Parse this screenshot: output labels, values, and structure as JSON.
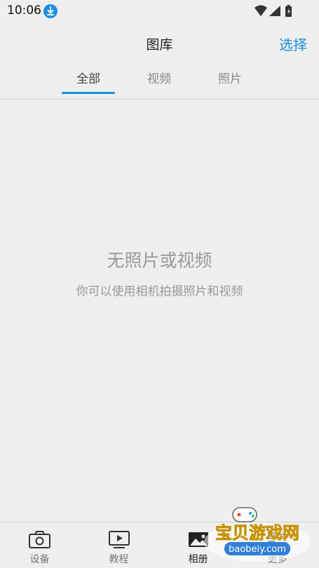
{
  "status_bar": {
    "time": "10:06"
  },
  "header": {
    "title": "图库",
    "select_label": "选择"
  },
  "tabs": [
    {
      "label": "全部",
      "active": true
    },
    {
      "label": "视频",
      "active": false
    },
    {
      "label": "照片",
      "active": false
    }
  ],
  "empty_state": {
    "title": "无照片或视频",
    "description": "你可以使用相机拍摄照片和视频"
  },
  "bottom_nav": [
    {
      "label": "设备",
      "icon": "camera-icon",
      "active": false
    },
    {
      "label": "教程",
      "icon": "play-screen-icon",
      "active": false
    },
    {
      "label": "相册",
      "icon": "gallery-icon",
      "active": true
    },
    {
      "label": "更多",
      "icon": "more-icon",
      "active": false
    }
  ],
  "watermark": {
    "text": "宝贝游戏网",
    "url": "baobeiy.com"
  },
  "colors": {
    "accent": "#1a8fe3",
    "background": "#efefef",
    "muted_text": "#999999"
  }
}
